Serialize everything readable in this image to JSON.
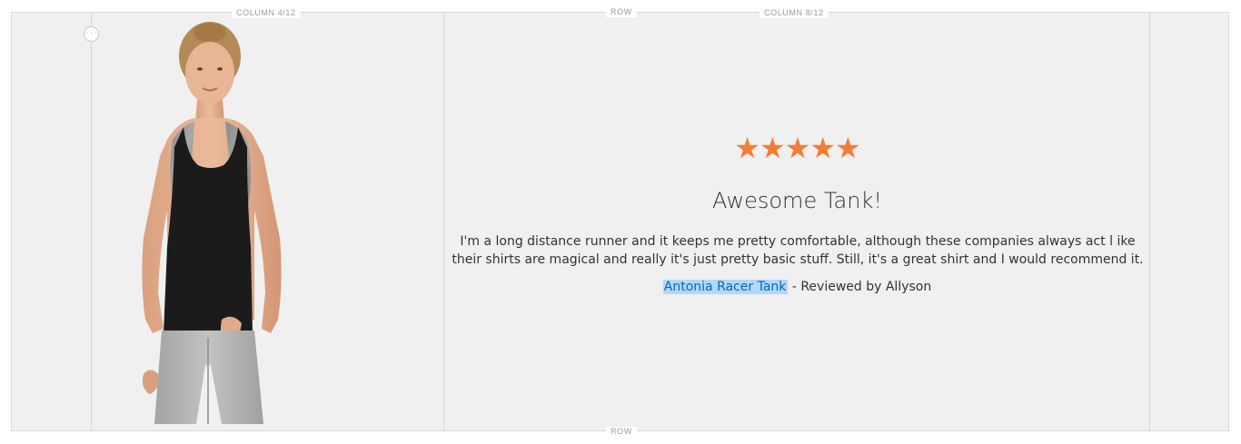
{
  "layout_labels": {
    "column_left": "COLUMN 4/12",
    "row_top": "ROW",
    "column_right": "COLUMN 8/12",
    "row_bottom": "ROW"
  },
  "handle": {
    "glyph": "· · ·"
  },
  "review": {
    "rating": 5,
    "stars": "★★★★★",
    "star_color": "#f27d35",
    "title": "Awesome Tank!",
    "body": "I'm a long distance runner and it keeps me pretty comfortable, although these companies always act l ike their shirts are magical and really it's just pretty basic stuff.  Still, it's a great shirt and I would recommend it.",
    "product_link": "Antonia Racer Tank",
    "reviewer_suffix": " - Reviewed by Allyson"
  },
  "product_image": {
    "icon": "woman-tank-top-product-photo"
  },
  "colors": {
    "link": "#006bb4",
    "link_highlight": "#b3d7fd",
    "stage_background": "#f0f0f0"
  }
}
